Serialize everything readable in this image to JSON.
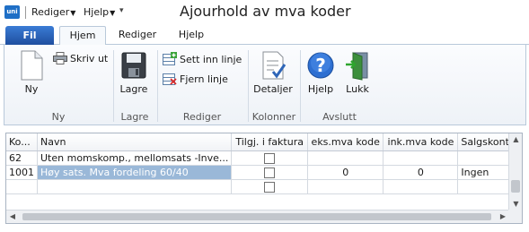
{
  "titlebar": {
    "logo_text": "uni",
    "menu1": "Rediger",
    "menu2": "Hjelp",
    "customize_glyph": "▾",
    "title": "Ajourhold av mva koder"
  },
  "tabs": {
    "file": "Fil",
    "home": "Hjem",
    "edit": "Rediger",
    "help": "Hjelp"
  },
  "ribbon": {
    "ny": {
      "new_label": "Ny",
      "print_label": "Skriv ut",
      "group": "Ny"
    },
    "lagre": {
      "save_label": "Lagre",
      "group": "Lagre"
    },
    "rediger": {
      "insert_label": "Sett inn linje",
      "remove_label": "Fjern linje",
      "group": "Rediger"
    },
    "kolonner": {
      "details_label": "Detaljer",
      "group": "Kolonner"
    },
    "avslutt": {
      "help_label": "Hjelp",
      "close_label": "Lukk",
      "group": "Avslutt"
    }
  },
  "grid": {
    "columns": [
      "Ko...",
      "Navn",
      "Tilgj. i faktura",
      "eks.mva kode",
      "ink.mva kode",
      "Salgskonto"
    ],
    "rows": [
      {
        "code": "62",
        "name": "Uten momskomp., mellomsats -Inve...",
        "eks": "",
        "ink": "",
        "account": ""
      },
      {
        "code": "1001",
        "name": "Høy sats. Mva fordeling 60/40",
        "eks": "0",
        "ink": "0",
        "account": "Ingen"
      },
      {
        "code": "",
        "name": "",
        "eks": "",
        "ink": "",
        "account": ""
      }
    ]
  },
  "icons": {
    "new": "new-document-icon",
    "print": "printer-icon",
    "save": "floppy-disk-icon",
    "insert": "insert-row-icon",
    "remove": "remove-row-icon",
    "details": "details-checklist-icon",
    "help": "help-question-icon",
    "close": "exit-door-icon"
  },
  "colors": {
    "file_tab": "#2b63b9",
    "selected_cell": "#9ab8d8",
    "ribbon_border": "#b9c9da"
  }
}
